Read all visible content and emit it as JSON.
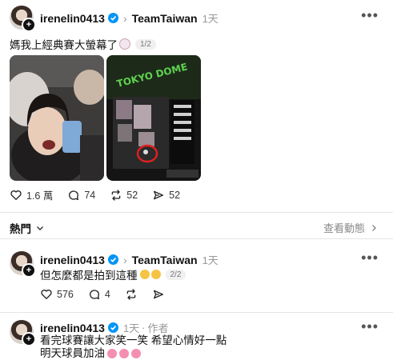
{
  "post": {
    "username": "irenelin0413",
    "group": "TeamTaiwan",
    "time": "1天",
    "text": "媽我上經典賽大螢幕了",
    "pager": "1/2",
    "stats": {
      "likes": "1.6 萬",
      "comments": "74",
      "reposts": "52",
      "shares": "52"
    },
    "image_right_sign": "TOKYO DOME"
  },
  "section": {
    "label": "熱門",
    "link": "查看動態"
  },
  "reply1": {
    "username": "irenelin0413",
    "group": "TeamTaiwan",
    "time": "1天",
    "text": "但怎麼都是拍到這種",
    "pager": "2/2",
    "stats": {
      "likes": "576",
      "comments": "4"
    }
  },
  "reply2": {
    "username": "irenelin0413",
    "time": "1天",
    "author_badge": "作者",
    "line1": "看完球賽讓大家笑一笑 希望心情好一點",
    "line2": "明天球員加油"
  },
  "colors": {
    "verified": "#0095f6",
    "muted": "#999999",
    "highlight_circle": "#e02020"
  },
  "icons": [
    "verified-icon",
    "more-icon",
    "heart-icon",
    "comment-icon",
    "repost-icon",
    "share-icon",
    "chevron-down-icon",
    "chevron-right-icon",
    "plus-icon",
    "flower-emoji",
    "laughing-emoji",
    "baseball-emoji"
  ]
}
